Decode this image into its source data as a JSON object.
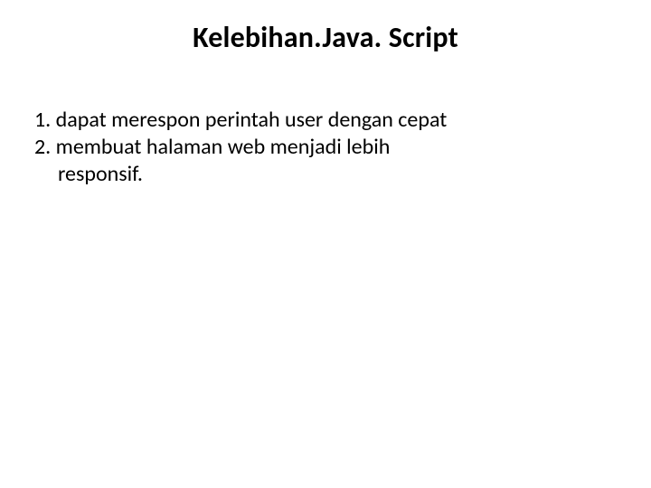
{
  "title": "Kelebihan.Java. Script",
  "points": {
    "p1": "1. dapat merespon perintah user dengan cepat",
    "p2": "2. membuat halaman web menjadi lebih",
    "p2_cont": "responsif."
  }
}
